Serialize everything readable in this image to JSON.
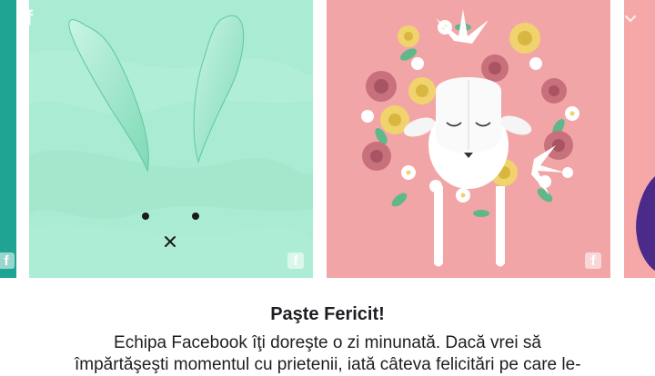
{
  "cards": [
    {
      "label": "bunny-card",
      "background": "#a9ecd3"
    },
    {
      "label": "lamb-card",
      "background": "#f2a5a6"
    }
  ],
  "badge_glyph": "f",
  "caption": {
    "title": "Paşte Fericit!",
    "line1": "Echipa Facebook îţi doreşte o zi minunată. Dacă vrei să",
    "line2": "împărtăşeşti momentul cu prietenii, iată câteva felicitări pe care le-"
  },
  "colors": {
    "mint": "#a9ecd3",
    "pink": "#f2a5a6",
    "teal": "#1fa493",
    "purple": "#4b2a8a"
  }
}
